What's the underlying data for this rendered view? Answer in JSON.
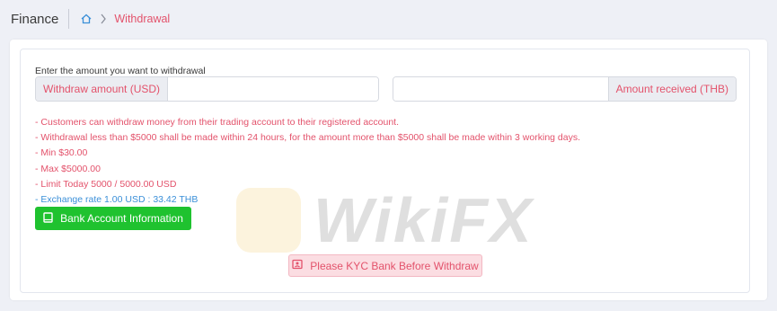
{
  "header": {
    "title": "Finance",
    "breadcrumb": {
      "current": "Withdrawal"
    }
  },
  "form": {
    "prompt": "Enter the amount you want to withdrawal",
    "withdraw": {
      "label": "Withdraw amount (USD)",
      "value": "",
      "placeholder": ""
    },
    "received": {
      "label": "Amount received (THB)",
      "value": "",
      "placeholder": ""
    }
  },
  "notes": [
    "- Customers can withdraw money from their trading account to their registered account.",
    "- Withdrawal less than $5000 shall be made within 24 hours, for the amount more than $5000 shall be made within 3 working days.",
    "- Min $30.00",
    "- Max $5000.00",
    "- Limit Today 5000 / 5000.00 USD"
  ],
  "exchange_rate": "- Exchange rate 1.00 USD : 33.42 THB",
  "buttons": {
    "bank_info": "Bank Account Information",
    "kyc": "Please KYC Bank Before Withdraw"
  },
  "watermark": {
    "text": "WikiFX"
  },
  "colors": {
    "accent": "#e3526b",
    "success": "#1fc22f",
    "info": "#3a8fd8",
    "kyc_bg": "#fbdde2"
  },
  "icons": {
    "home": "home-icon",
    "chevron": "chevron-right-icon",
    "bank": "book-icon",
    "kyc": "id-card-icon"
  }
}
